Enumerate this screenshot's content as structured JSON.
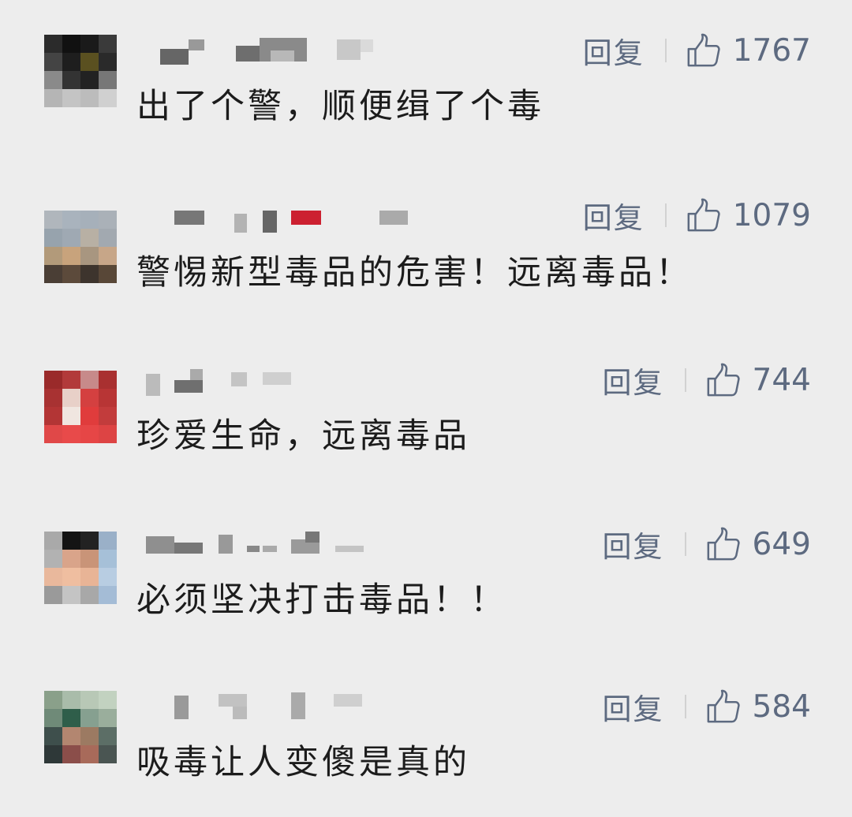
{
  "colors": {
    "background": "#ededed",
    "text": "#1c1c1c",
    "action": "#5d6a80"
  },
  "comments": [
    {
      "reply_label": "回复",
      "like_icon": "thumbs-up-icon",
      "likes": "1767",
      "text": "出了个警，顺便缉了个毒"
    },
    {
      "reply_label": "回复",
      "like_icon": "thumbs-up-icon",
      "likes": "1079",
      "text": "警惕新型毒品的危害！远离毒品！"
    },
    {
      "reply_label": "回复",
      "like_icon": "thumbs-up-icon",
      "likes": "744",
      "text": "珍爱生命，远离毒品"
    },
    {
      "reply_label": "回复",
      "like_icon": "thumbs-up-icon",
      "likes": "649",
      "text": "必须坚决打击毒品！！"
    },
    {
      "reply_label": "回复",
      "like_icon": "thumbs-up-icon",
      "likes": "584",
      "text": "吸毒让人变傻是真的"
    }
  ]
}
